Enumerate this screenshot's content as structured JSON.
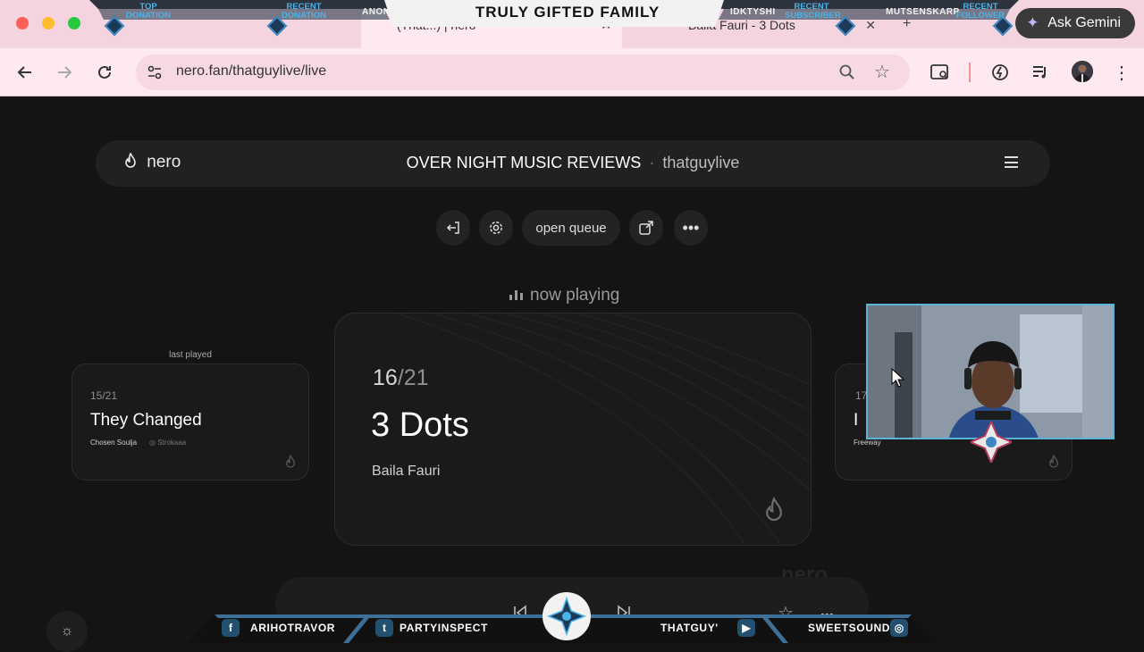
{
  "browser": {
    "tabs": [
      "(That...) | nero",
      "Baila Fauri - 3 Dots"
    ],
    "url": "nero.fan/thatguylive/live",
    "gemini_label": "Ask Gemini",
    "gemini_icon": "sparkle-icon"
  },
  "overlay_top": {
    "title": "TRULY GIFTED FAMILY",
    "top_donation_label": "TOP DONATION",
    "recent_donation_label": "RECENT DONATION",
    "recent_donation_name": "ANONYMOUS:",
    "recent_subscriber_label": "RECENT SUBSCRIBER",
    "recent_subscriber_name": "IDKTYSHI",
    "recent_follower_label": "RECENT FOLLOWER",
    "recent_follower_name": "MUTSENSKARP"
  },
  "nero": {
    "logo": "nero",
    "stream_title": "OVER NIGHT MUSIC REVIEWS",
    "separator": "·",
    "channel": "thatguylive",
    "open_queue_label": "open queue",
    "now_playing_label": "now playing",
    "last_played_label": "last played",
    "watermark": "nero",
    "last_played": {
      "position": "15/21",
      "title": "They Changed",
      "artist": "Chosen Soulja",
      "handle": "Strokaaa"
    },
    "now_playing": {
      "position_current": "16",
      "position_total": "/21",
      "title": "3 Dots",
      "artist": "Baila Fauri"
    },
    "next": {
      "position": "17",
      "title_initial": "I",
      "artist": "Freeway"
    }
  },
  "overlay_bottom": {
    "facebook": "ARIHOTRAVOR",
    "twitter": "PARTYINSPECT",
    "youtube_prefix": "THATGUY'",
    "instagram": "SWEETSOUNDI"
  },
  "colors": {
    "tabstrip": "#f4d4df",
    "toolbar": "#fde9ef",
    "page_bg": "#141414",
    "overlay_accent": "#4ab3e8"
  }
}
